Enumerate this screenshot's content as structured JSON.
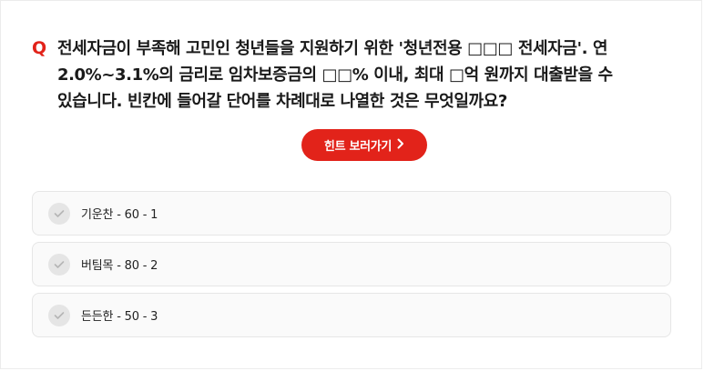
{
  "quiz": {
    "question_mark": "Q",
    "question_text": "전세자금이 부족해 고민인 청년들을 지원하기 위한 '청년전용 □□□ 전세자금'. 연 2.0%~3.1%의 금리로 임차보증금의 □□% 이내, 최대 □억 원까지 대출받을 수 있습니다. 빈칸에 들어갈 단어를 차례대로 나열한 것은 무엇일까요?",
    "hint_label": "힌트 보러가기",
    "hint_icon": "chevron-right-icon",
    "check_icon": "check-icon",
    "options": [
      {
        "label": "기운찬 - 60 - 1"
      },
      {
        "label": "버팀목 - 80 - 2"
      },
      {
        "label": "든든한 - 50 - 3"
      }
    ],
    "colors": {
      "accent": "#e2231a",
      "option_bg": "#fafafa",
      "check_bg": "#e5e5e5"
    }
  }
}
